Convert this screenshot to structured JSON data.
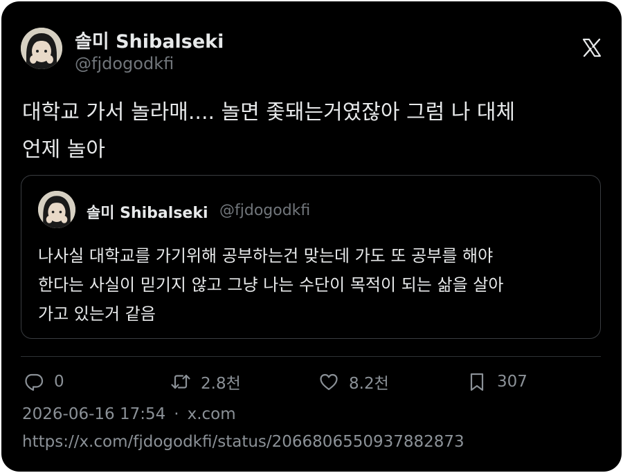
{
  "author": {
    "name": "솔미 Shibalseki",
    "handle": "@fjdogodkfi"
  },
  "tweet": {
    "text": "대학교 가서 놀라매.... 놀면 좇돼는거였잖아 그럼 나 대체\n언제 놀아"
  },
  "quote": {
    "name": "솔미 Shibalseki",
    "handle": "@fjdogodkfi",
    "text": "나사실 대학교를 가기위해 공부하는건 맞는데 가도 또 공부를 해야\n한다는 사실이 믿기지 않고 그냥 나는 수단이 목적이 되는 삶을 살아\n가고 있는거 같음"
  },
  "actions": {
    "replies": "0",
    "retweets": "2.8천",
    "likes": "8.2천",
    "bookmarks": "307"
  },
  "meta": {
    "timestamp": "2026-06-16 17:54",
    "separator": "·",
    "source": "x.com"
  },
  "url": "https://x.com/fjdogodkfi/status/2066806550937882873",
  "icons": {
    "logo": "x-logo-icon",
    "reply": "reply-icon",
    "retweet": "retweet-icon",
    "like": "heart-icon",
    "bookmark": "bookmark-icon"
  },
  "colors": {
    "background": "#000000",
    "text": "#e7e9ea",
    "secondary": "#71767b",
    "border": "#3a3d41"
  }
}
